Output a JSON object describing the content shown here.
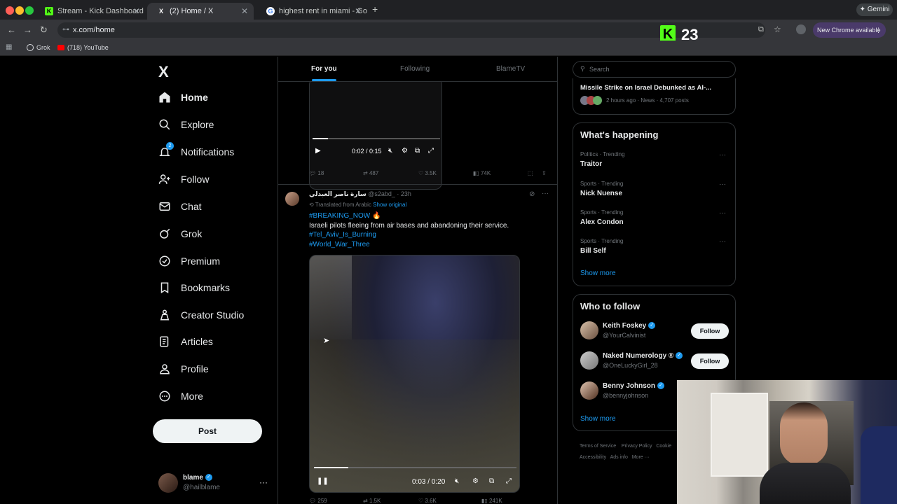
{
  "browser": {
    "tabs": [
      {
        "title": "Stream - Kick Dashboard",
        "favicon": "K"
      },
      {
        "title": "(2) Home / X",
        "favicon": "X"
      },
      {
        "title": "highest rent in miami - Googl",
        "favicon": "G"
      }
    ],
    "url": "x.com/home",
    "bookmarks": [
      {
        "label": "Grok"
      },
      {
        "label": "(718) YouTube"
      }
    ],
    "gemini_label": "Gemini",
    "new_chrome_label": "New Chrome available",
    "kick_overlay_count": "23"
  },
  "sidebar": {
    "logo": "X",
    "items": [
      {
        "label": "Home",
        "icon": "home-icon"
      },
      {
        "label": "Explore",
        "icon": "search-icon"
      },
      {
        "label": "Notifications",
        "icon": "bell-icon",
        "badge": "2"
      },
      {
        "label": "Follow",
        "icon": "person-add-icon"
      },
      {
        "label": "Chat",
        "icon": "mail-icon"
      },
      {
        "label": "Grok",
        "icon": "grok-icon"
      },
      {
        "label": "Premium",
        "icon": "premium-icon"
      },
      {
        "label": "Bookmarks",
        "icon": "bookmark-icon"
      },
      {
        "label": "Creator Studio",
        "icon": "creator-studio-icon"
      },
      {
        "label": "Articles",
        "icon": "articles-icon"
      },
      {
        "label": "Profile",
        "icon": "profile-icon"
      },
      {
        "label": "More",
        "icon": "more-icon"
      }
    ],
    "post_label": "Post",
    "account": {
      "name": "blame",
      "handle": "@hailblame"
    }
  },
  "feed": {
    "tabs": [
      "For you",
      "Following",
      "BlameTV"
    ],
    "post1": {
      "video_time": "0:02 / 0:15",
      "replies": "18",
      "reposts": "487",
      "likes": "3.5K",
      "views": "74K"
    },
    "post2": {
      "author": "سارة ناصر العبدلي",
      "handle": "@s2abd_",
      "time": "· 23h",
      "translated": "Translated from Arabic",
      "show_original": "Show original",
      "line1": "#BREAKING_NOW 🔥",
      "line2": "Israeli pilots fleeing from air bases and abandoning their service.",
      "line3": "#Tel_Aviv_Is_Burning",
      "line4": "#World_War_Three",
      "video_time": "0:03 / 0:20",
      "replies": "259",
      "reposts": "1.5K",
      "likes": "3.6K",
      "views": "241K"
    }
  },
  "right": {
    "search_placeholder": "Search",
    "news_headline": "Missile Strike on Israel Debunked as AI-...",
    "news_meta": "2 hours ago · News · 4,707 posts",
    "whats_happening": "What's happening",
    "trends": [
      {
        "meta": "Politics · Trending",
        "name": "Traitor"
      },
      {
        "meta": "Sports · Trending",
        "name": "Nick Nuense"
      },
      {
        "meta": "Sports · Trending",
        "name": "Alex Condon"
      },
      {
        "meta": "Sports · Trending",
        "name": "Bill Self"
      }
    ],
    "show_more": "Show more",
    "who_to_follow": "Who to follow",
    "follow_suggestions": [
      {
        "name": "Keith Foskey",
        "handle": "@YourCalvinist",
        "button": "Follow"
      },
      {
        "name": "Naked Numerology ®",
        "handle": "@OneLuckyGirl_28",
        "button": "Follow"
      },
      {
        "name": "Benny Johnson",
        "handle": "@bennyjohnson"
      }
    ],
    "show_more_2": "Show more",
    "footer": [
      "Terms of Service",
      "Privacy Policy",
      "Cookie",
      "Accessibility",
      "Ads info",
      "More ···"
    ]
  }
}
